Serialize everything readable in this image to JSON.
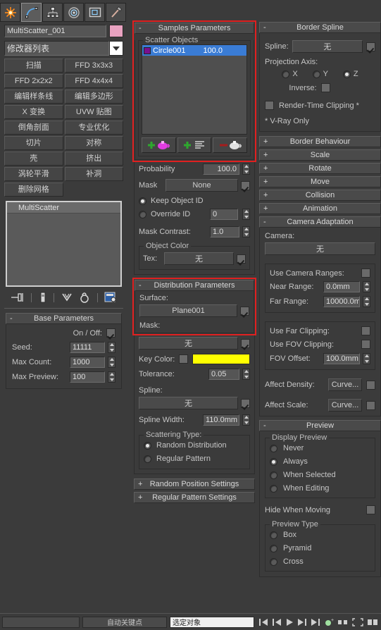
{
  "toolbar": {
    "tabs": [
      {
        "name": "create-tab",
        "icon": "star-icon"
      },
      {
        "name": "modify-tab",
        "icon": "curve-icon",
        "active": true
      },
      {
        "name": "hierarchy-tab",
        "icon": "hierarchy-icon"
      },
      {
        "name": "motion-tab",
        "icon": "motion-icon"
      },
      {
        "name": "display-tab",
        "icon": "display-icon"
      },
      {
        "name": "utilities-tab",
        "icon": "hammer-icon"
      }
    ]
  },
  "left": {
    "object_name": "MultiScatter_001",
    "object_color": "#e8a2c0",
    "modifier_list_label": "修改器列表",
    "modifier_buttons": [
      "扫描",
      "FFD 3x3x3",
      "FFD 2x2x2",
      "FFD 4x4x4",
      "编辑样条线",
      "编辑多边形",
      "X 变换",
      "UVW 贴图",
      "倒角剖面",
      "专业优化",
      "切片",
      "对称",
      "壳",
      "挤出",
      "涡轮平滑",
      "补洞",
      "删除网格"
    ],
    "stack_items": [
      "MultiScatter"
    ],
    "stack_icons": [
      "pin-icon",
      "show-end-result-icon",
      "make-unique-icon",
      "remove-modifier-icon",
      "configure-sets-icon"
    ],
    "base_parameters": {
      "title": "Base Parameters",
      "collapse": "-",
      "on_off_label": "On / Off:",
      "on_off_checked": true,
      "seed_label": "Seed:",
      "seed_value": "11111",
      "max_count_label": "Max Count:",
      "max_count_value": "1000",
      "max_preview_label": "Max Preview:",
      "max_preview_value": "100"
    }
  },
  "middle": {
    "samples": {
      "title": "Samples Parameters",
      "collapse": "-",
      "highlighted": true,
      "scatter_objects_label": "Scatter Objects",
      "objects": [
        {
          "name": "Circle001",
          "value": "100.0",
          "color": "#7a0f8e",
          "selected": true
        }
      ],
      "buttons": [
        {
          "name": "add-object-button",
          "icon": "plus-teapot-icon"
        },
        {
          "name": "add-list-button",
          "icon": "plus-list-icon"
        },
        {
          "name": "remove-object-button",
          "icon": "minus-teapot-icon"
        }
      ],
      "probability_label": "Probability",
      "probability_value": "100.0",
      "mask_label": "Mask",
      "mask_value": "None",
      "mask_checked": true,
      "keep_object_id_label": "Keep Object ID",
      "keep_object_id_selected": true,
      "override_id_label": "Override ID",
      "override_id_value": "0",
      "mask_contrast_label": "Mask Contrast:",
      "mask_contrast_value": "1.0",
      "object_color_label": "Object Color",
      "tex_label": "Tex:",
      "tex_value": "无",
      "tex_checked": true
    },
    "distribution": {
      "title": "Distribution Parameters",
      "collapse": "-",
      "highlighted": true,
      "surface_label": "Surface:",
      "surface_value": "Plane001",
      "surface_checked": true,
      "mask_label": "Mask:",
      "mask_value": "无",
      "mask_checked": true,
      "key_color_label": "Key Color:",
      "key_color_checked": false,
      "key_color": "#ffff00",
      "tolerance_label": "Tolerance:",
      "tolerance_value": "0.05",
      "spline_label": "Spline:",
      "spline_value": "无",
      "spline_checked": true,
      "spline_width_label": "Spline Width:",
      "spline_width_value": "110.0mm",
      "scattering_type_label": "Scattering Type:",
      "random_distribution_label": "Random Distribution",
      "random_distribution_selected": true,
      "regular_pattern_label": "Regular Pattern",
      "regular_pattern_selected": false
    },
    "collapsed_rollouts": [
      {
        "label": "Random Position Settings",
        "state": "+"
      },
      {
        "label": "Regular Pattern Settings",
        "state": "+"
      }
    ]
  },
  "right": {
    "border_spline": {
      "title": "Border Spline",
      "collapse": "-",
      "spline_label": "Spline:",
      "spline_value": "无",
      "spline_checked": true,
      "projection_axis_label": "Projection Axis:",
      "axes": [
        {
          "label": "X",
          "selected": false
        },
        {
          "label": "Y",
          "selected": false
        },
        {
          "label": "Z",
          "selected": true
        }
      ],
      "inverse_label": "Inverse:",
      "inverse_checked": false,
      "render_time_clipping_label": "Render-Time Clipping *",
      "render_time_clipping_checked": false,
      "vray_note": "* V-Ray Only"
    },
    "collapsed_rollouts": [
      {
        "label": "Border Behaviour",
        "state": "+"
      },
      {
        "label": "Scale",
        "state": "+"
      },
      {
        "label": "Rotate",
        "state": "+"
      },
      {
        "label": "Move",
        "state": "+"
      },
      {
        "label": "Collision",
        "state": "+"
      },
      {
        "label": "Animation",
        "state": "+"
      }
    ],
    "camera_adaptation": {
      "title": "Camera Adaptation",
      "collapse": "-",
      "camera_label": "Camera:",
      "camera_value": "无",
      "use_camera_ranges_label": "Use Camera Ranges:",
      "use_camera_ranges_checked": false,
      "near_range_label": "Near Range:",
      "near_range_value": "0.0mm",
      "far_range_label": "Far Range:",
      "far_range_value": "10000.0m",
      "use_far_clipping_label": "Use Far Clipping:",
      "use_far_clipping_checked": false,
      "use_fov_clipping_label": "Use FOV Clipping:",
      "use_fov_clipping_checked": false,
      "fov_offset_label": "FOV Offset:",
      "fov_offset_value": "100.0mm",
      "affect_density_label": "Affect Density:",
      "affect_density_button": "Curve...",
      "affect_density_checked": false,
      "affect_scale_label": "Affect Scale:",
      "affect_scale_button": "Curve...",
      "affect_scale_checked": false
    },
    "preview": {
      "title": "Preview",
      "collapse": "-",
      "display_preview_label": "Display Preview",
      "display_options": [
        {
          "label": "Never",
          "selected": false
        },
        {
          "label": "Always",
          "selected": true
        },
        {
          "label": "When Selected",
          "selected": false
        },
        {
          "label": "When Editing",
          "selected": false
        }
      ],
      "hide_when_moving_label": "Hide When Moving",
      "hide_when_moving_checked": false,
      "preview_type_label": "Preview Type",
      "preview_types": [
        {
          "label": "Box",
          "selected": false
        },
        {
          "label": "Pyramid",
          "selected": false
        },
        {
          "label": "Cross",
          "selected": false
        }
      ]
    }
  },
  "statusbar": {
    "select_object_value": "选定对象",
    "note": "自动关键点"
  }
}
